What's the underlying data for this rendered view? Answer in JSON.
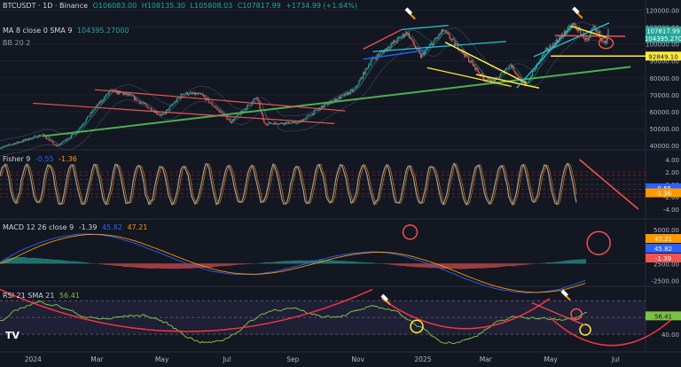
{
  "header": {
    "symbol": "BTCUSDT · 1D · Binance",
    "open": "O106083.00",
    "high": "H108135.30",
    "low": "L105808.03",
    "close": "C107817.99",
    "change": "+1734.99 (+1.64%)",
    "ma_label": "MA 8 close 0 SMA 9",
    "ma_value": "104395.27000",
    "bb_label": "BB 20 2"
  },
  "fisher_header": {
    "label": "Fisher 9",
    "v1": "-0.55",
    "v2": "-1.36"
  },
  "macd_header": {
    "label": "MACD 12 26 close 9",
    "v1": "-1.39",
    "v2": "45.82",
    "v3": "47.21"
  },
  "rsi_header": {
    "label": "RSI 21 SMA 21",
    "v1": "56.41"
  },
  "colors": {
    "up": "#26a69a",
    "down": "#ef5350",
    "green": "#4caf50",
    "fisher": "#9e9e9e",
    "signal": "#ff9800",
    "macd": "#2962ff",
    "macd_signal": "#ff9800",
    "rsi": "#7bc043",
    "pink": "#f23645",
    "yellow": "#ffeb3b",
    "cyan": "#26c6da",
    "blue": "#2962ff"
  },
  "chart_data": [
    {
      "type": "candlestick",
      "title": "BTCUSDT · 1D · Binance",
      "y_ticks": [
        40000,
        50000,
        60000,
        70000,
        80000,
        90000,
        100000,
        110000,
        120000
      ],
      "y_tick_labels": [
        "40000.00",
        "50000.00",
        "60000.00",
        "70000.00",
        "80000.00",
        "90000.00",
        "100000.00",
        "110000.00",
        "120000.00"
      ],
      "ylim": [
        38000,
        126000
      ],
      "x_ticks": [
        "2024",
        "Mar",
        "May",
        "Jul",
        "Sep",
        "Nov",
        "2025",
        "Mar",
        "May",
        "Jul"
      ],
      "x_tick_dates": [
        "2024-01-01",
        "2024-03-01",
        "2024-05-01",
        "2024-07-01",
        "2024-09-01",
        "2024-11-01",
        "2025-01-01",
        "2025-03-01",
        "2025-05-01",
        "2025-07-01"
      ],
      "price_path": [
        [
          "2023-12-01",
          38700
        ],
        [
          "2024-01-10",
          46500
        ],
        [
          "2024-01-23",
          39500
        ],
        [
          "2024-02-10",
          47500
        ],
        [
          "2024-02-28",
          62000
        ],
        [
          "2024-03-14",
          72500
        ],
        [
          "2024-04-01",
          69500
        ],
        [
          "2024-05-01",
          57500
        ],
        [
          "2024-05-21",
          71000
        ],
        [
          "2024-06-07",
          70000
        ],
        [
          "2024-07-05",
          54000
        ],
        [
          "2024-07-29",
          68500
        ],
        [
          "2024-08-05",
          53000
        ],
        [
          "2024-09-06",
          53500
        ],
        [
          "2024-10-01",
          64000
        ],
        [
          "2024-10-29",
          73000
        ],
        [
          "2024-11-13",
          90000
        ],
        [
          "2024-12-05",
          101000
        ],
        [
          "2024-12-17",
          107000
        ],
        [
          "2024-12-30",
          92500
        ],
        [
          "2025-01-20",
          108000
        ],
        [
          "2025-02-05",
          97000
        ],
        [
          "2025-02-28",
          79000
        ],
        [
          "2025-03-10",
          78500
        ],
        [
          "2025-03-24",
          88000
        ],
        [
          "2025-04-07",
          75000
        ],
        [
          "2025-04-25",
          95000
        ],
        [
          "2025-05-10",
          104000
        ],
        [
          "2025-05-22",
          111800
        ],
        [
          "2025-06-05",
          101000
        ],
        [
          "2025-06-10",
          110000
        ],
        [
          "2025-06-22",
          100000
        ],
        [
          "2025-06-24",
          107818
        ]
      ],
      "price_tags": [
        {
          "value": "107817.99",
          "price": 107818,
          "color": "#26a69a"
        },
        {
          "value": "104395.270",
          "price": 104395,
          "color": "#26a69a"
        },
        {
          "value": "92849.10",
          "price": 92849,
          "color": "#ffeb3b"
        }
      ],
      "bb": {
        "upper_offset": 4500,
        "lower_offset": 4500
      }
    },
    {
      "type": "line",
      "title": "Fisher 9",
      "y_ticks": [
        4.0,
        2.0,
        0.0,
        -2.0,
        -4.0
      ],
      "y_tick_labels": [
        "4.00",
        "2.00",
        "0.00",
        "-2.00",
        "-4.00"
      ],
      "ylim": [
        -5.0,
        5.0
      ],
      "latest": [
        -0.55,
        -1.36
      ],
      "levels": [
        2.0,
        1.5,
        0.75,
        0.0,
        -0.75,
        -1.5,
        -2.0
      ]
    },
    {
      "type": "line",
      "title": "MACD 12 26 close 9",
      "y_ticks": [
        5000.0,
        0.0,
        -2500.0
      ],
      "y_tick_labels": [
        "5000.00",
        "2500.00",
        "-2500.00"
      ],
      "ylim": [
        -3200,
        6400
      ],
      "latest": {
        "histogram": -1.39,
        "macd": 45.82,
        "signal": 47.21
      }
    },
    {
      "type": "line",
      "title": "RSI 21 SMA 21",
      "y_ticks": [
        40.0
      ],
      "y_tick_labels": [
        "40.00"
      ],
      "ylim": [
        25,
        82
      ],
      "latest": 56.41,
      "band": [
        40,
        70
      ]
    }
  ],
  "x_axis_labels": [
    "2024",
    "Mar",
    "May",
    "Jul",
    "Sep",
    "Nov",
    "2025",
    "Mar",
    "May",
    "Jul"
  ],
  "logo": "TV"
}
